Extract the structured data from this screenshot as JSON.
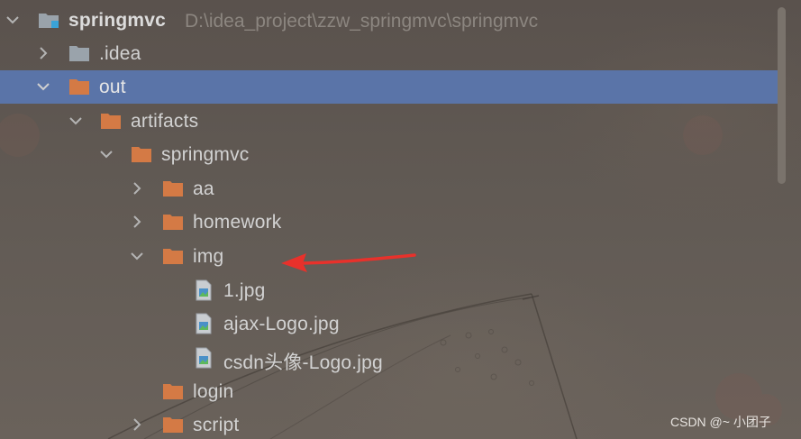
{
  "project_tree": {
    "root": {
      "name": "springmvc",
      "path": "D:\\idea_project\\zzw_springmvc\\springmvc"
    },
    "items": [
      {
        "label": ".idea"
      },
      {
        "label": "out"
      },
      {
        "label": "artifacts"
      },
      {
        "label": "springmvc"
      },
      {
        "label": "aa"
      },
      {
        "label": "homework"
      },
      {
        "label": "img"
      },
      {
        "label": "1.jpg"
      },
      {
        "label": "ajax-Logo.jpg"
      },
      {
        "label": "csdn头像-Logo.jpg"
      },
      {
        "label": "login"
      },
      {
        "label": "script"
      }
    ]
  },
  "colors": {
    "selection": "#5a74a8",
    "folder_orange": "#d47a45",
    "folder_gray": "#9aa3ab",
    "annotation_arrow": "#e8312b"
  },
  "watermark": "CSDN @~ 小团子"
}
